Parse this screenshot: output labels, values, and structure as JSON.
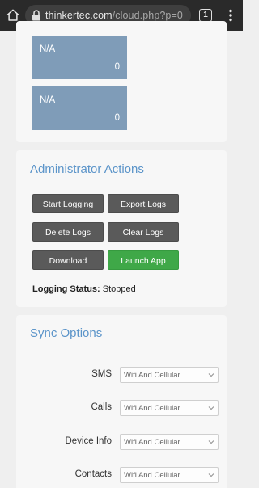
{
  "browser": {
    "url_host": "thinkertec.com",
    "url_path": "/cloud.php?p=0",
    "tab_count": "1"
  },
  "tiles": [
    {
      "label": "N/A",
      "value": "0"
    },
    {
      "label": "N/A",
      "value": "0"
    }
  ],
  "admin": {
    "title": "Administrator Actions",
    "buttons": {
      "start_logging": "Start Logging",
      "export_logs": "Export Logs",
      "delete_logs": "Delete Logs",
      "clear_logs": "Clear Logs",
      "download": "Download",
      "launch_app": "Launch App"
    },
    "status_label": "Logging Status:",
    "status_value": "Stopped"
  },
  "sync": {
    "title": "Sync Options",
    "rows": [
      {
        "label": "SMS",
        "selected": "Wifi And Cellular"
      },
      {
        "label": "Calls",
        "selected": "Wifi And Cellular"
      },
      {
        "label": "Device Info",
        "selected": "Wifi And Cellular"
      },
      {
        "label": "Contacts",
        "selected": "Wifi And Cellular"
      }
    ]
  },
  "colors": {
    "tile": "#7f9cb8",
    "title_blue": "#5b94c9",
    "button_dark": "#5a5a5a",
    "button_green": "#3fa848"
  }
}
